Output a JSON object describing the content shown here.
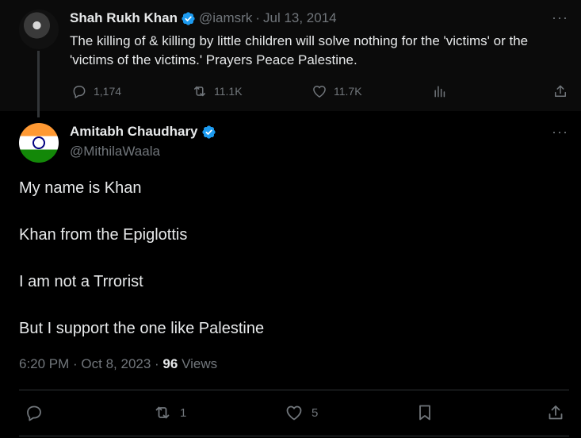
{
  "parent_tweet": {
    "name": "Shah Rukh Khan",
    "handle": "@iamsrk",
    "separator": "·",
    "date": "Jul 13, 2014",
    "text": "The killing of & killing by little children will solve nothing  for the 'victims' or the 'victims of the victims.' Prayers Peace Palestine.",
    "more": "···",
    "replies": "1,174",
    "retweets": "11.1K",
    "likes": "11.7K"
  },
  "reply_tweet": {
    "name": "Amitabh Chaudhary",
    "handle": "@MithilaWaala",
    "more": "···",
    "lines": [
      "My name is Khan",
      "Khan from the Epiglottis",
      "I am not a Trrorist",
      "But I support the one like Palestine"
    ],
    "time": "6:20 PM · Oct 8, 2023 · ",
    "views_count": "96",
    "views_label": " Views",
    "retweets": "1",
    "likes": "5"
  },
  "colors": {
    "verified": "#1d9bf0",
    "muted": "#71767b",
    "text": "#e7e9ea"
  }
}
